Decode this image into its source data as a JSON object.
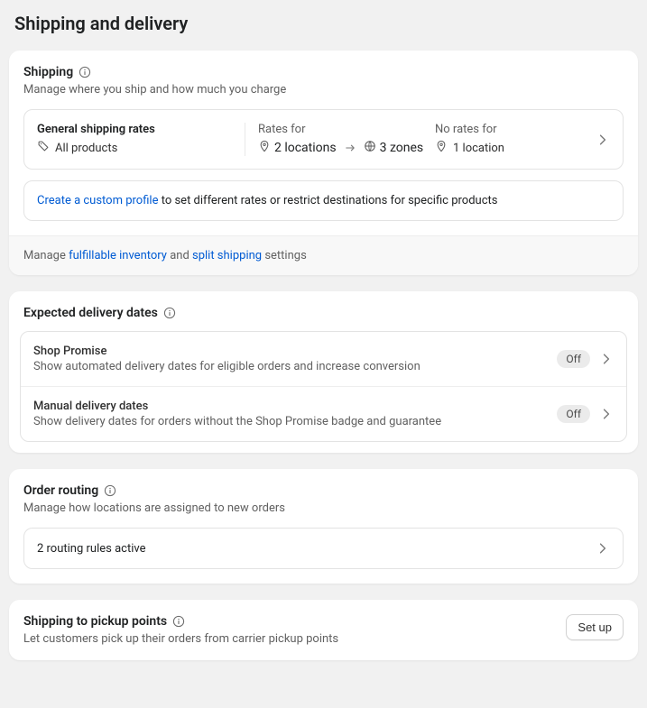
{
  "page": {
    "title": "Shipping and delivery"
  },
  "shipping": {
    "title": "Shipping",
    "desc": "Manage where you ship and how much you charge",
    "general": {
      "title": "General shipping rates",
      "scope": "All products"
    },
    "rates": {
      "label": "Rates for",
      "locations": "2 locations",
      "zones": "3 zones"
    },
    "no_rates": {
      "label": "No rates for",
      "locations": "1 location"
    },
    "custom": {
      "link": "Create a custom profile",
      "suffix": " to set different rates or restrict destinations for specific products"
    },
    "footer": {
      "pre": "Manage ",
      "link1": "fulfillable inventory",
      "mid": " and ",
      "link2": "split shipping",
      "post": " settings"
    }
  },
  "delivery": {
    "title": "Expected delivery dates",
    "shop_promise": {
      "title": "Shop Promise",
      "desc": "Show automated delivery dates for eligible orders and increase conversion",
      "status": "Off"
    },
    "manual": {
      "title": "Manual delivery dates",
      "desc": "Show delivery dates for orders without the Shop Promise badge and guarantee",
      "status": "Off"
    }
  },
  "routing": {
    "title": "Order routing",
    "desc": "Manage how locations are assigned to new orders",
    "summary": "2 routing rules active"
  },
  "pickup": {
    "title": "Shipping to pickup points",
    "desc": "Let customers pick up their orders from carrier pickup points",
    "button": "Set up"
  }
}
